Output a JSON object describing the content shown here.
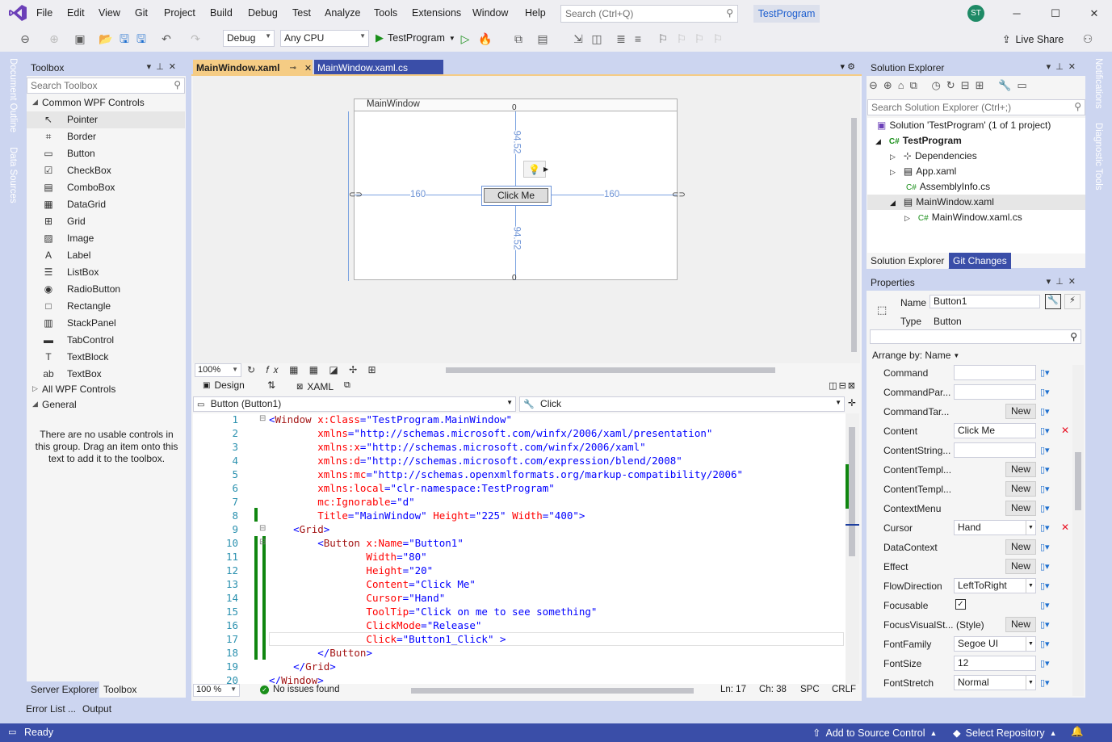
{
  "menu": {
    "items": [
      "File",
      "Edit",
      "View",
      "Git",
      "Project",
      "Build",
      "Debug",
      "Test",
      "Analyze",
      "Tools",
      "Extensions",
      "Window",
      "Help"
    ],
    "search_placeholder": "Search (Ctrl+Q)",
    "solution_name": "TestProgram",
    "avatar_initials": "ST"
  },
  "toolbar": {
    "config": "Debug",
    "platform": "Any CPU",
    "run_label": "TestProgram",
    "live_share": "Live Share"
  },
  "left_strip": {
    "document_outline": "Document Outline",
    "data_sources": "Data Sources"
  },
  "right_strip": {
    "notifications": "Notifications",
    "diagnostic_tools": "Diagnostic Tools"
  },
  "toolbox": {
    "title": "Toolbox",
    "search_placeholder": "Search Toolbox",
    "group_common": "Common WPF Controls",
    "items": [
      {
        "label": "Pointer",
        "icon": "↖"
      },
      {
        "label": "Border",
        "icon": "⌗"
      },
      {
        "label": "Button",
        "icon": "▭"
      },
      {
        "label": "CheckBox",
        "icon": "☑"
      },
      {
        "label": "ComboBox",
        "icon": "▤"
      },
      {
        "label": "DataGrid",
        "icon": "▦"
      },
      {
        "label": "Grid",
        "icon": "⊞"
      },
      {
        "label": "Image",
        "icon": "▨"
      },
      {
        "label": "Label",
        "icon": "A"
      },
      {
        "label": "ListBox",
        "icon": "☰"
      },
      {
        "label": "RadioButton",
        "icon": "◉"
      },
      {
        "label": "Rectangle",
        "icon": "□"
      },
      {
        "label": "StackPanel",
        "icon": "▥"
      },
      {
        "label": "TabControl",
        "icon": "▬"
      },
      {
        "label": "TextBlock",
        "icon": "T"
      },
      {
        "label": "TextBox",
        "icon": "ab"
      }
    ],
    "group_all": "All WPF Controls",
    "group_general": "General",
    "empty_message": "There are no usable controls in this group. Drag an item onto this text to add it to the toolbox.",
    "tab_server_explorer": "Server Explorer",
    "tab_toolbox": "Toolbox"
  },
  "doc_tabs": {
    "active": "MainWindow.xaml",
    "inactive": "MainWindow.xaml.cs"
  },
  "designer": {
    "window_title": "MainWindow",
    "button_text": "Click Me",
    "margin_left": "160",
    "margin_right": "160",
    "margin_top": "94.52",
    "margin_bottom": "94.52",
    "zoom": "100%",
    "tab_design": "Design",
    "tab_xaml": "XAML"
  },
  "nav": {
    "element": "Button (Button1)",
    "event": "Click"
  },
  "code": {
    "line_numbers": [
      "1",
      "2",
      "3",
      "4",
      "5",
      "6",
      "7",
      "8",
      "9",
      "10",
      "11",
      "12",
      "13",
      "14",
      "15",
      "16",
      "17",
      "18",
      "19",
      "20"
    ],
    "lines": [
      "<Window x:Class=\"TestProgram.MainWindow\"",
      "        xmlns=\"http://schemas.microsoft.com/winfx/2006/xaml/presentation\"",
      "        xmlns:x=\"http://schemas.microsoft.com/winfx/2006/xaml\"",
      "        xmlns:d=\"http://schemas.microsoft.com/expression/blend/2008\"",
      "        xmlns:mc=\"http://schemas.openxmlformats.org/markup-compatibility/2006\"",
      "        xmlns:local=\"clr-namespace:TestProgram\"",
      "        mc:Ignorable=\"d\"",
      "        Title=\"MainWindow\" Height=\"225\" Width=\"400\">",
      "    <Grid>",
      "        <Button x:Name=\"Button1\"",
      "                Width=\"80\"",
      "                Height=\"20\"",
      "                Content=\"Click Me\"",
      "                Cursor=\"Hand\"",
      "                ToolTip=\"Click on me to see something\"",
      "                ClickMode=\"Release\"",
      "                Click=\"Button1_Click\" >",
      "        </Button>",
      "    </Grid>",
      "</Window>"
    ]
  },
  "editor_status": {
    "zoom": "100 %",
    "issues": "No issues found",
    "line": "Ln: 17",
    "col": "Ch: 38",
    "spc": "SPC",
    "eol": "CRLF"
  },
  "solution_explorer": {
    "title": "Solution Explorer",
    "search_placeholder": "Search Solution Explorer (Ctrl+;)",
    "solution": "Solution 'TestProgram' (1 of 1 project)",
    "project": "TestProgram",
    "dependencies": "Dependencies",
    "app_xaml": "App.xaml",
    "assembly_info": "AssemblyInfo.cs",
    "main_window": "MainWindow.xaml",
    "main_window_cs": "MainWindow.xaml.cs",
    "tab_solution": "Solution Explorer",
    "tab_git": "Git Changes"
  },
  "properties": {
    "title": "Properties",
    "name_label": "Name",
    "name_value": "Button1",
    "type_label": "Type",
    "type_value": "Button",
    "arrange_by": "Arrange by: Name",
    "new_label": "New",
    "rows": [
      {
        "name": "Command",
        "kind": "text",
        "value": ""
      },
      {
        "name": "CommandPar...",
        "kind": "text",
        "value": ""
      },
      {
        "name": "CommandTar...",
        "kind": "new",
        "value": ""
      },
      {
        "name": "Content",
        "kind": "text",
        "value": "Click Me"
      },
      {
        "name": "ContentString...",
        "kind": "text",
        "value": ""
      },
      {
        "name": "ContentTempl...",
        "kind": "new",
        "value": ""
      },
      {
        "name": "ContentTempl...",
        "kind": "new",
        "value": ""
      },
      {
        "name": "ContextMenu",
        "kind": "new",
        "value": ""
      },
      {
        "name": "Cursor",
        "kind": "combo",
        "value": "Hand"
      },
      {
        "name": "DataContext",
        "kind": "new",
        "value": ""
      },
      {
        "name": "Effect",
        "kind": "new",
        "value": ""
      },
      {
        "name": "FlowDirection",
        "kind": "combo",
        "value": "LeftToRight"
      },
      {
        "name": "Focusable",
        "kind": "check",
        "value": ""
      },
      {
        "name": "FocusVisualSt...",
        "kind": "style",
        "value": "(Style)"
      },
      {
        "name": "FontFamily",
        "kind": "combo",
        "value": "Segoe UI"
      },
      {
        "name": "FontSize",
        "kind": "text",
        "value": "12"
      },
      {
        "name": "FontStretch",
        "kind": "combo",
        "value": "Normal"
      }
    ]
  },
  "bottom_tabs": {
    "error_list": "Error List ...",
    "output": "Output"
  },
  "status": {
    "ready": "Ready",
    "add_source": "Add to Source Control",
    "select_repo": "Select Repository"
  },
  "colors": {
    "accent": "#3a4ea8",
    "tab_active": "#f5cc84",
    "selection": "#6d93d6"
  }
}
